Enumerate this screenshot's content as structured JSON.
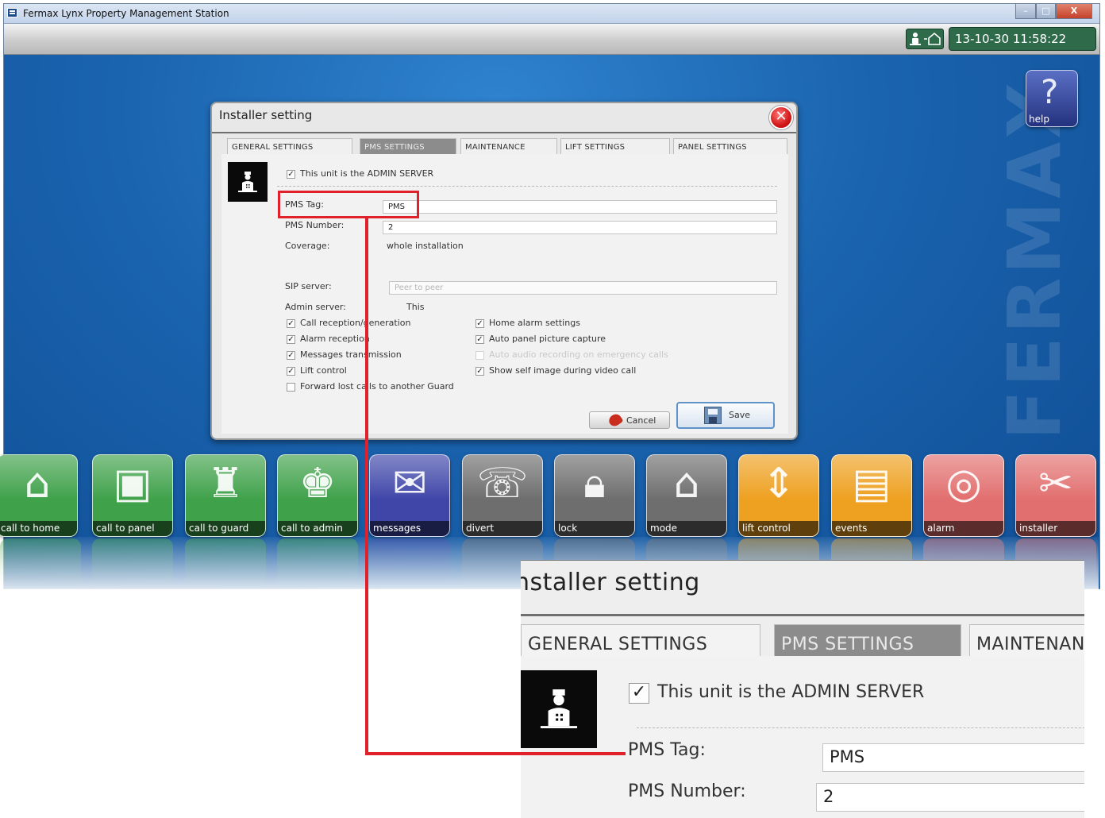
{
  "window": {
    "title": "Fermax Lynx Property Management Station",
    "controls": {
      "minimize": "–",
      "maximize": "□",
      "close": "X"
    }
  },
  "toolbar": {
    "status_icon": "network-status-icon",
    "datetime": "13-10-30 11:58:22"
  },
  "watermark": "FERMAX",
  "help": {
    "label": "help",
    "icon": "question-mark-icon"
  },
  "dialog": {
    "title": "Installer setting",
    "tabs": [
      {
        "label": "GENERAL SETTINGS",
        "active": false
      },
      {
        "label": "PMS SETTINGS",
        "active": true
      },
      {
        "label": "MAINTENANCE",
        "active": false
      },
      {
        "label": "LIFT SETTINGS",
        "active": false
      },
      {
        "label": "PANEL SETTINGS",
        "active": false
      }
    ],
    "admin_server_checkbox": {
      "label": "This unit is the ADMIN SERVER",
      "checked": true
    },
    "pms_tag": {
      "label": "PMS Tag:",
      "value": "PMS"
    },
    "pms_number": {
      "label": "PMS Number:",
      "value": "2"
    },
    "coverage": {
      "label": "Coverage:",
      "value": "whole installation"
    },
    "sip_server": {
      "label": "SIP server:",
      "placeholder": "Peer to peer"
    },
    "admin_server": {
      "label": "Admin server:",
      "value": "This"
    },
    "options_left": [
      {
        "label": "Call reception/generation",
        "checked": true,
        "enabled": true
      },
      {
        "label": "Alarm reception",
        "checked": true,
        "enabled": true
      },
      {
        "label": "Messages transmission",
        "checked": true,
        "enabled": true
      },
      {
        "label": "Lift control",
        "checked": true,
        "enabled": true
      },
      {
        "label": "Forward lost calls to another Guard",
        "checked": false,
        "enabled": true
      }
    ],
    "options_right": [
      {
        "label": "Home alarm settings",
        "checked": true,
        "enabled": true
      },
      {
        "label": "Auto panel picture capture",
        "checked": true,
        "enabled": true
      },
      {
        "label": "Auto audio recording on emergency calls",
        "checked": false,
        "enabled": false
      },
      {
        "label": "Show self image during video call",
        "checked": true,
        "enabled": true
      }
    ],
    "cancel_label": "Cancel",
    "save_label": "Save"
  },
  "dock": [
    {
      "label": "call to home",
      "icon": "house-bell-icon",
      "color": "#3fa14a"
    },
    {
      "label": "call to panel",
      "icon": "panel-bell-icon",
      "color": "#3fa14a"
    },
    {
      "label": "call to guard",
      "icon": "guard-bell-icon",
      "color": "#3fa14a"
    },
    {
      "label": "call to admin",
      "icon": "admin-bell-icon",
      "color": "#3fa14a"
    },
    {
      "label": "messages",
      "icon": "envelope-icon",
      "color": "#3f46a8"
    },
    {
      "label": "divert",
      "icon": "phone-divert-icon",
      "color": "#6e6e6e"
    },
    {
      "label": "lock",
      "icon": "padlock-icon",
      "color": "#6e6e6e"
    },
    {
      "label": "mode",
      "icon": "house-gear-icon",
      "color": "#6e6e6e"
    },
    {
      "label": "lift control",
      "icon": "lift-icon",
      "color": "#eea020"
    },
    {
      "label": "events",
      "icon": "document-stack-icon",
      "color": "#eea020"
    },
    {
      "label": "alarm",
      "icon": "alarm-bell-icon",
      "color": "#e26f6f"
    },
    {
      "label": "installer",
      "icon": "tools-icon",
      "color": "#e26f6f"
    }
  ],
  "inset": {
    "title": "nstaller setting",
    "tabs": [
      "GENERAL SETTINGS",
      "PMS SETTINGS",
      "MAINTENANC"
    ],
    "admin_server_label": "This unit is the ADMIN SERVER",
    "pms_tag_label": "PMS Tag:",
    "pms_tag_value": "PMS",
    "pms_number_label": "PMS Number:",
    "pms_number_value": "2"
  },
  "highlight_color": "#e0202a"
}
